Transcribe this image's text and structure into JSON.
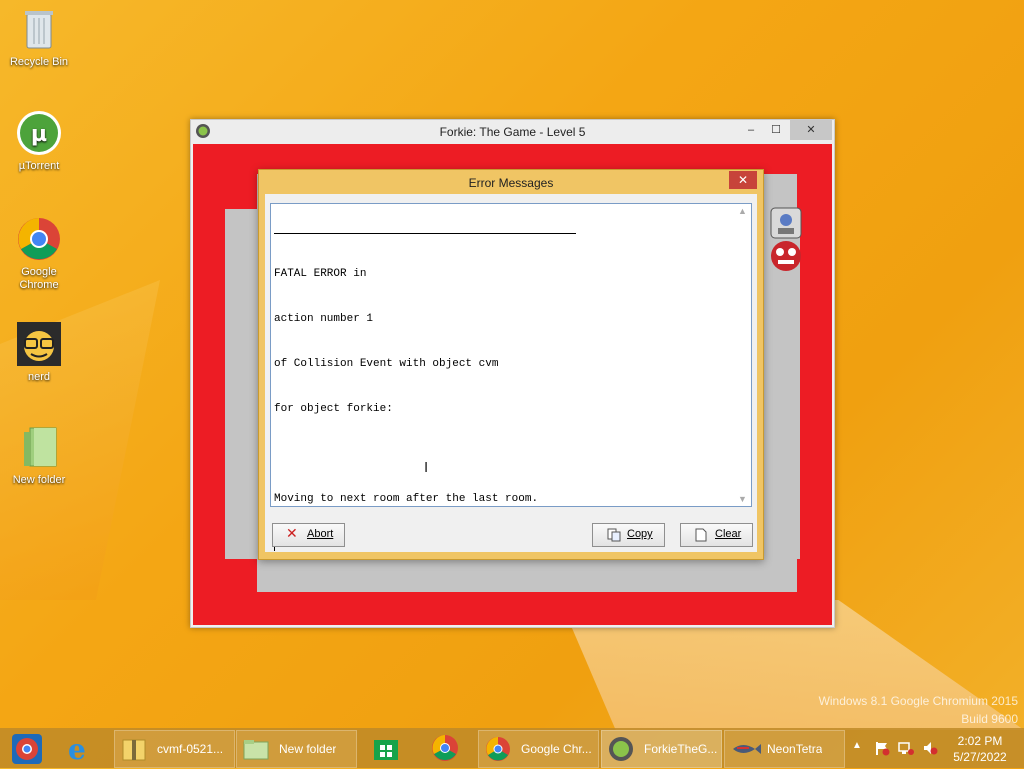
{
  "desktop": {
    "icons": [
      {
        "label": "Recycle Bin"
      },
      {
        "label": "µTorrent"
      },
      {
        "label": "Google Chrome"
      },
      {
        "label": "nerd"
      },
      {
        "label": "New folder"
      }
    ],
    "watermark": {
      "line1": "Windows 8.1 Google Chromium 2015",
      "line2": "Build 9600"
    }
  },
  "game_window": {
    "title": "Forkie: The Game - Level 5",
    "minimize": "–",
    "maximize": "☐",
    "close": "✕"
  },
  "error_dialog": {
    "title": "Error Messages",
    "close": "✕",
    "message_lines": [
      "FATAL ERROR in",
      "action number 1",
      "of Collision Event with object cvm",
      "for object forkie:",
      "",
      "Moving to next room after the last room."
    ],
    "buttons": {
      "abort": "Abort",
      "copy": "Copy",
      "clear": "Clear"
    }
  },
  "taskbar": {
    "items": [
      {
        "label": "cvmf-0521..."
      },
      {
        "label": "New folder"
      },
      {
        "label": "Google Chr..."
      },
      {
        "label": "ForkieTheG..."
      },
      {
        "label": "NeonTetra"
      }
    ],
    "clock": {
      "time": "2:02 PM",
      "date": "5/27/2022"
    }
  },
  "colors": {
    "game_red": "#ed1c24",
    "dialog_accent": "#f0c564",
    "taskbar": "#be8a28"
  }
}
